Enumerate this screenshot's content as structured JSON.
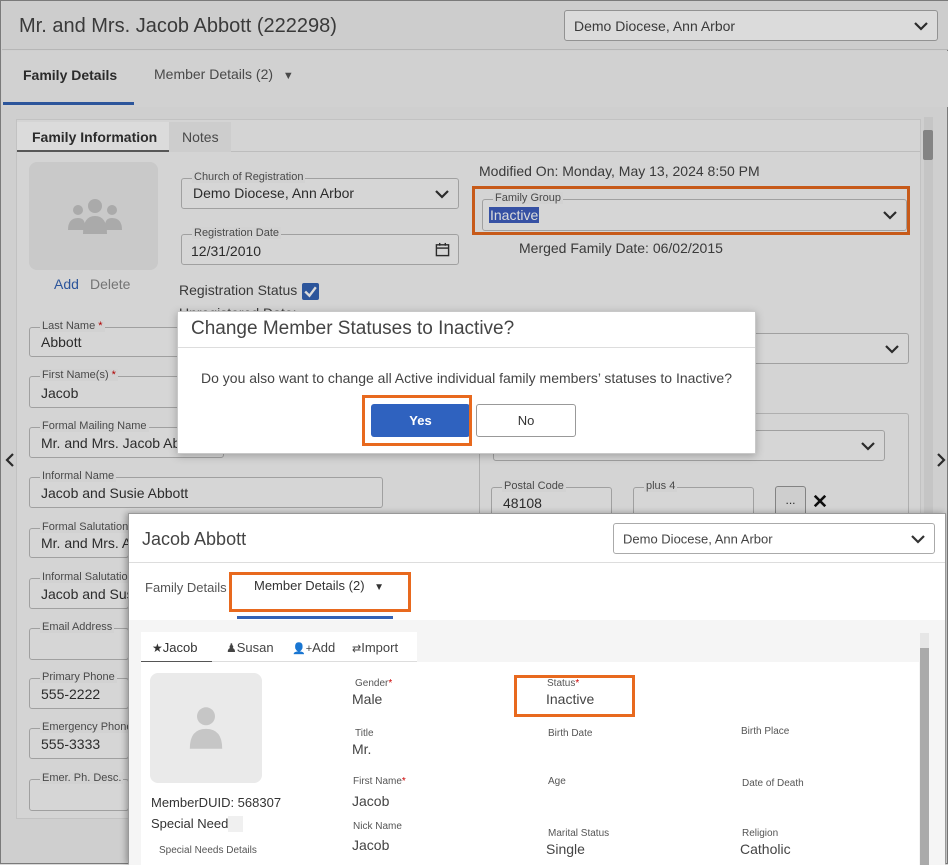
{
  "header": {
    "title": "Mr. and Mrs. Jacob Abbott (222298)",
    "diocese": "Demo Diocese, Ann Arbor"
  },
  "tabs": [
    {
      "label": "Family Details"
    },
    {
      "label": "Member Details (2)"
    }
  ],
  "subtabs": [
    {
      "label": "Family Information"
    },
    {
      "label": "Notes"
    }
  ],
  "photo": {
    "add": "Add",
    "delete": "Delete"
  },
  "fields": {
    "church_label": "Church of Registration",
    "church_value": "Demo Diocese, Ann Arbor",
    "regdate_label": "Registration Date",
    "regdate_value": "12/31/2010",
    "regstatus_label": "Registration Status",
    "unregistered_label": "Unregistered Date:",
    "modified": "Modified On: Monday, May 13, 2024 8:50 PM",
    "family_group_label": "Family Group",
    "family_group_value": "Inactive",
    "merged": "Merged Family Date: 06/02/2015",
    "lastname_label": "Last Name",
    "lastname_value": "Abbott",
    "firstnames_label": "First Name(s)",
    "firstnames_value": "Jacob",
    "formal_mailing_label": "Formal Mailing Name",
    "formal_mailing_value": "Mr. and Mrs. Jacob Abbott",
    "informal_name_label": "Informal Name",
    "informal_name_value": "Jacob and Susie Abbott",
    "formal_salutation_label": "Formal Salutation",
    "formal_salutation_value": "Mr. and Mrs. Abbott",
    "informal_salutation_label": "Informal Salutation",
    "informal_salutation_value": "Jacob and Susie",
    "email_label": "Email Address",
    "primary_phone_label": "Primary Phone",
    "primary_phone_value": "555-2222",
    "emergency_phone_label": "Emergency Phone",
    "emergency_phone_value": "555-3333",
    "emer_desc_label": "Emer. Ph. Desc.",
    "postal_label": "Postal Code",
    "postal_value": "48108",
    "plus4_label": "plus 4",
    "ellipsis": "..."
  },
  "dialog": {
    "title": "Change Member Statuses to Inactive?",
    "message": "Do you also want to change all Active individual family members’ statuses to Inactive?",
    "yes": "Yes",
    "no": "No"
  },
  "member_window": {
    "title": "Jacob Abbott",
    "diocese": "Demo Diocese, Ann Arbor",
    "tabs": [
      {
        "label": "Family Details"
      },
      {
        "label": "Member Details (2)"
      }
    ],
    "members": [
      {
        "label": "Jacob"
      },
      {
        "label": "Susan"
      },
      {
        "label": "Add"
      },
      {
        "label": "Import"
      }
    ],
    "memberduid": "MemberDUID: 568307",
    "special_needs": "Special Needs",
    "special_needs_details": "Special Needs Details",
    "gender_label": "Gender",
    "gender_value": "Male",
    "status_label": "Status",
    "status_value": "Inactive",
    "title_label": "Title",
    "title_value": "Mr.",
    "birthdate_label": "Birth Date",
    "birthplace_label": "Birth Place",
    "firstname_label": "First Name",
    "firstname_value": "Jacob",
    "age_label": "Age",
    "dateofdeath_label": "Date of Death",
    "nickname_label": "Nick Name",
    "nickname_value": "Jacob",
    "marital_label": "Marital Status",
    "marital_value": "Single",
    "religion_label": "Religion",
    "religion_value": "Catholic"
  },
  "colors": {
    "accent": "#3463b5",
    "highlight": "#e8691e",
    "yes_button": "#2f62bf"
  }
}
